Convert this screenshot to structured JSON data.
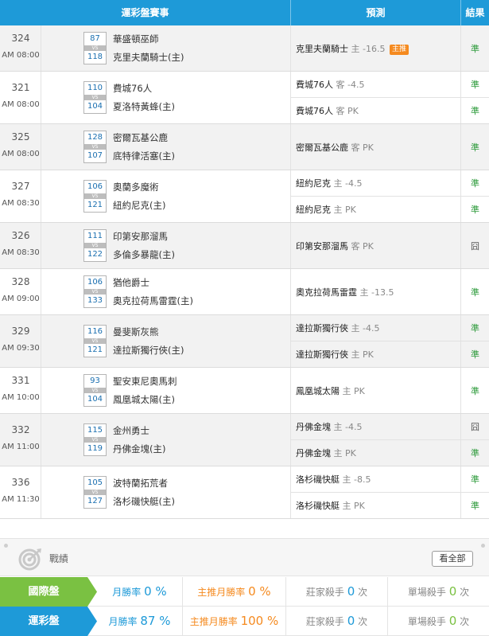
{
  "header": {
    "match": "運彩盤賽事",
    "prediction": "預測",
    "result": "結果"
  },
  "games": [
    {
      "no": "324",
      "time": "AM 08:00",
      "score_away": "87",
      "score_home": "118",
      "away": "華盛頓巫師",
      "home": "克里夫蘭騎士(主)",
      "picks": [
        {
          "team": "克里夫蘭騎士",
          "side": "主",
          "odds": "-16.5",
          "tag": "主推",
          "result": "準"
        }
      ]
    },
    {
      "no": "321",
      "time": "AM 08:00",
      "score_away": "110",
      "score_home": "104",
      "away": "費城76人",
      "home": "夏洛特黃蜂(主)",
      "picks": [
        {
          "team": "費城76人",
          "side": "客",
          "odds": "-4.5",
          "result": "準"
        },
        {
          "team": "費城76人",
          "side": "客",
          "odds": "PK",
          "result": "準"
        }
      ]
    },
    {
      "no": "325",
      "time": "AM 08:00",
      "score_away": "128",
      "score_home": "107",
      "away": "密爾瓦基公鹿",
      "home": "底特律活塞(主)",
      "picks": [
        {
          "team": "密爾瓦基公鹿",
          "side": "客",
          "odds": "PK",
          "result": "準"
        }
      ]
    },
    {
      "no": "327",
      "time": "AM 08:30",
      "score_away": "106",
      "score_home": "121",
      "away": "奧蘭多魔術",
      "home": "紐約尼克(主)",
      "picks": [
        {
          "team": "紐約尼克",
          "side": "主",
          "odds": "-4.5",
          "result": "準"
        },
        {
          "team": "紐約尼克",
          "side": "主",
          "odds": "PK",
          "result": "準"
        }
      ]
    },
    {
      "no": "326",
      "time": "AM 08:30",
      "score_away": "111",
      "score_home": "122",
      "away": "印第安那溜馬",
      "home": "多倫多暴龍(主)",
      "picks": [
        {
          "team": "印第安那溜馬",
          "side": "客",
          "odds": "PK",
          "result": "囧"
        }
      ]
    },
    {
      "no": "328",
      "time": "AM 09:00",
      "score_away": "106",
      "score_home": "133",
      "away": "猶他爵士",
      "home": "奧克拉荷馬雷霆(主)",
      "picks": [
        {
          "team": "奧克拉荷馬雷霆",
          "side": "主",
          "odds": "-13.5",
          "result": "準"
        }
      ]
    },
    {
      "no": "329",
      "time": "AM 09:30",
      "score_away": "116",
      "score_home": "121",
      "away": "曼斐斯灰熊",
      "home": "達拉斯獨行俠(主)",
      "picks": [
        {
          "team": "達拉斯獨行俠",
          "side": "主",
          "odds": "-4.5",
          "result": "準"
        },
        {
          "team": "達拉斯獨行俠",
          "side": "主",
          "odds": "PK",
          "result": "準"
        }
      ]
    },
    {
      "no": "331",
      "time": "AM 10:00",
      "score_away": "93",
      "score_home": "104",
      "away": "聖安東尼奧馬刺",
      "home": "鳳凰城太陽(主)",
      "picks": [
        {
          "team": "鳳凰城太陽",
          "side": "主",
          "odds": "PK",
          "result": "準"
        }
      ]
    },
    {
      "no": "332",
      "time": "AM 11:00",
      "score_away": "115",
      "score_home": "119",
      "away": "金州勇士",
      "home": "丹佛金塊(主)",
      "picks": [
        {
          "team": "丹佛金塊",
          "side": "主",
          "odds": "-4.5",
          "result": "囧"
        },
        {
          "team": "丹佛金塊",
          "side": "主",
          "odds": "PK",
          "result": "準"
        }
      ]
    },
    {
      "no": "336",
      "time": "AM 11:30",
      "score_away": "105",
      "score_home": "127",
      "away": "波特蘭拓荒者",
      "home": "洛杉磯快艇(主)",
      "picks": [
        {
          "team": "洛杉磯快艇",
          "side": "主",
          "odds": "-8.5",
          "result": "準"
        },
        {
          "team": "洛杉磯快艇",
          "side": "主",
          "odds": "PK",
          "result": "準"
        }
      ]
    }
  ],
  "record": {
    "label": "戰績",
    "view_all": "看全部",
    "icon": "target-icon"
  },
  "stats_rows": [
    {
      "label": "國際盤",
      "color": "#7ac142",
      "monthly_label": "月勝率",
      "monthly": "0 %",
      "top_label": "主推月勝率",
      "top": "0 %",
      "banker_label": "莊家殺手",
      "banker": "0",
      "banker_unit": "次",
      "single_label": "單場殺手",
      "single": "0",
      "single_unit": "次"
    },
    {
      "label": "運彩盤",
      "color": "#1e9ad8",
      "monthly_label": "月勝率",
      "monthly": "87 %",
      "top_label": "主推月勝率",
      "top": "100 %",
      "banker_label": "莊家殺手",
      "banker": "0",
      "banker_unit": "次",
      "single_label": "單場殺手",
      "single": "0",
      "single_unit": "次"
    }
  ],
  "colors": {
    "header": "#1e9ad8",
    "win": "#2e9b3c",
    "tag": "#f58a1f"
  }
}
